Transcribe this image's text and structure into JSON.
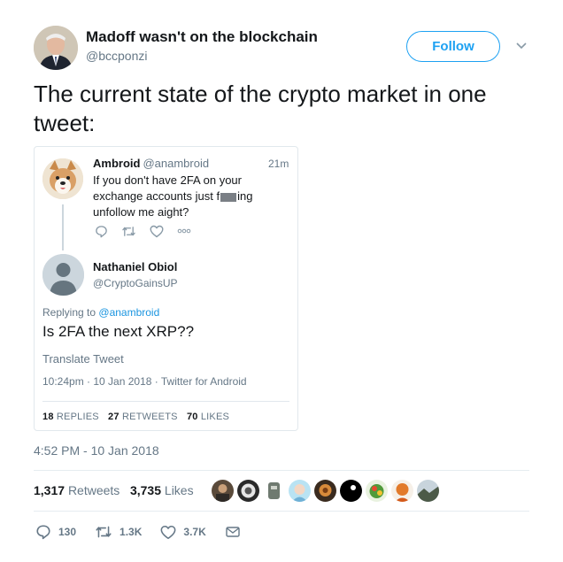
{
  "author": {
    "name": "Madoff wasn't on the blockchain",
    "handle": "@bccponzi",
    "follow_label": "Follow"
  },
  "tweet_text": "The current state of the crypto market in one tweet:",
  "quoted": {
    "first": {
      "name": "Ambroid",
      "handle": "@anambroid",
      "time": "21m",
      "text_before": "If you don't have 2FA on your exchange accounts just f",
      "text_after": "ing unfollow me aight?"
    },
    "reply": {
      "name": "Nathaniel Obiol",
      "handle": "@CryptoGainsUP",
      "replying_prefix": "Replying to",
      "replying_to": "@anambroid",
      "text": "Is 2FA the next XRP??",
      "translate": "Translate Tweet",
      "meta": "10:24pm · 10 Jan 2018 · Twitter for Android",
      "replies_count": "18",
      "replies_label": "REPLIES",
      "retweets_count": "27",
      "retweets_label": "RETWEETS",
      "likes_count": "70",
      "likes_label": "LIKES"
    }
  },
  "timestamp": "4:52 PM - 10 Jan 2018",
  "stats": {
    "retweets_count": "1,317",
    "retweets_label": "Retweets",
    "likes_count": "3,735",
    "likes_label": "Likes"
  },
  "actions": {
    "reply_count": "130",
    "retweet_count": "1.3K",
    "like_count": "3.7K"
  },
  "colors": {
    "accent": "#1da1f2",
    "secondary_text": "#657786",
    "border": "#e1e8ed"
  },
  "icons": [
    "chevron-down-icon",
    "reply-icon",
    "retweet-icon",
    "heart-icon",
    "more-icon",
    "dm-icon"
  ]
}
